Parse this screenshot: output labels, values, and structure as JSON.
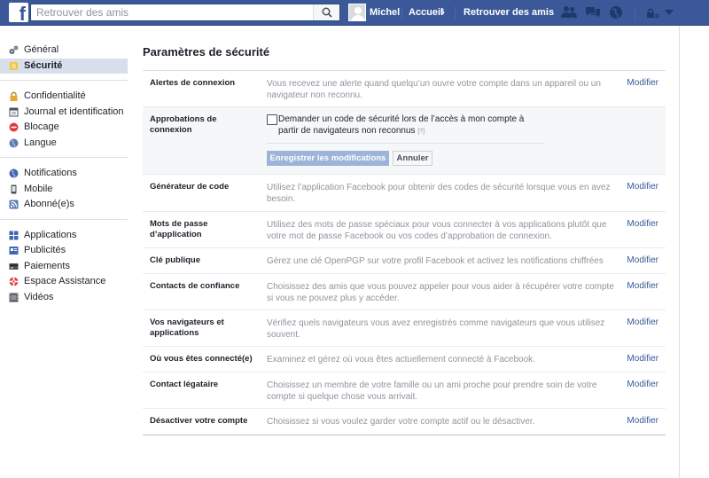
{
  "topbar": {
    "logo": "f",
    "search_placeholder": "Retrouver des amis",
    "user_name": "Michel",
    "home_label": "Accueil",
    "home_count": "5",
    "find_friends_label": "Retrouver des amis"
  },
  "sidebar": {
    "groups": [
      [
        {
          "label": "Général",
          "icon": "gear-icon"
        },
        {
          "label": "Sécurité",
          "icon": "shield-icon",
          "active": true
        }
      ],
      [
        {
          "label": "Confidentialité",
          "icon": "lock-icon"
        },
        {
          "label": "Journal et identification",
          "icon": "journal-icon"
        },
        {
          "label": "Blocage",
          "icon": "block-icon"
        },
        {
          "label": "Langue",
          "icon": "globe-icon"
        }
      ],
      [
        {
          "label": "Notifications",
          "icon": "globe-icon"
        },
        {
          "label": "Mobile",
          "icon": "mobile-icon"
        },
        {
          "label": "Abonné(e)s",
          "icon": "rss-icon"
        }
      ],
      [
        {
          "label": "Applications",
          "icon": "apps-icon"
        },
        {
          "label": "Publicités",
          "icon": "ads-icon"
        },
        {
          "label": "Paiements",
          "icon": "payment-icon"
        },
        {
          "label": "Espace Assistance",
          "icon": "lifebuoy-icon"
        },
        {
          "label": "Vidéos",
          "icon": "video-icon"
        }
      ]
    ]
  },
  "main": {
    "title": "Paramètres de sécurité",
    "edit_label": "Modifier",
    "rows": [
      {
        "label": "Alertes de connexion",
        "desc": "Vous recevez une alerte quand quelqu’un ouvre votre compte dans un appareil ou un navigateur non reconnu."
      },
      {
        "label": "Approbations de connexion",
        "expanded": true,
        "checkbox_text": "Demander un code de sécurité lors de l’accès à mon compte à partir de navigateurs non reconnus",
        "help": "[?]",
        "save_label": "Enregistrer les modifications",
        "cancel_label": "Annuler"
      },
      {
        "label": "Générateur de code",
        "desc": "Utilisez l’application Facebook pour obtenir des codes de sécurité lorsque vous en avez besoin."
      },
      {
        "label": "Mots de passe d’application",
        "desc": "Utilisez des mots de passe spéciaux pour vous connecter à vos applications plutôt que votre mot de passe Facebook ou vos codes d’approbation de connexion."
      },
      {
        "label": "Clé publique",
        "desc": "Gérez une clé OpenPGP sur votre profil Facebook et activez les notifications chiffrées"
      },
      {
        "label": "Contacts de confiance",
        "desc": "Choisissez des amis que vous pouvez appeler pour vous aider à récupérer votre compte si vous ne pouvez plus y accéder."
      },
      {
        "label": "Vos navigateurs et applications",
        "desc": "Vérifiez quels navigateurs vous avez enregistrés comme navigateurs que vous utilisez souvent."
      },
      {
        "label": "Où vous êtes connecté(e)",
        "desc": "Examinez et gérez où vous êtes actuellement connecté à Facebook."
      },
      {
        "label": "Contact légataire",
        "desc": "Choisissez un membre de votre famille ou un ami proche pour prendre soin de votre compte si quelque chose vous arrivait."
      },
      {
        "label": "Désactiver votre compte",
        "desc": "Choisissez si vous voulez garder votre compte actif ou le désactiver."
      }
    ]
  }
}
